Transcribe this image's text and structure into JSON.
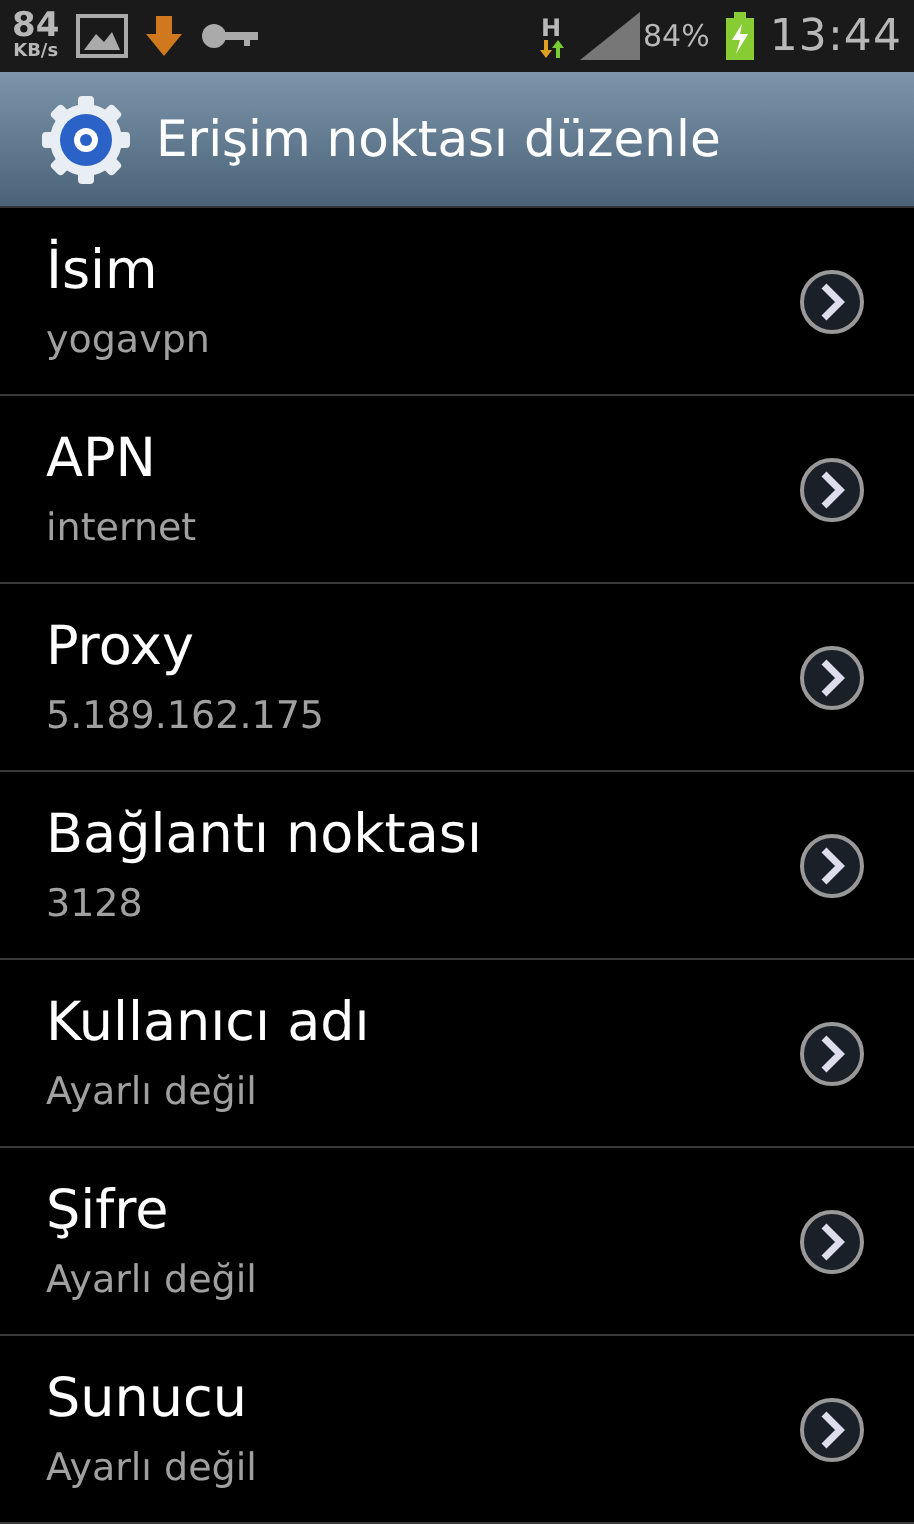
{
  "status_bar": {
    "speed": "84",
    "speed_unit": "KB/s",
    "network_type": "H",
    "battery": "84%",
    "time": "13:44"
  },
  "header": {
    "title": "Erişim noktası düzenle"
  },
  "settings": [
    {
      "label": "İsim",
      "value": "yogavpn"
    },
    {
      "label": "APN",
      "value": "internet"
    },
    {
      "label": "Proxy",
      "value": "5.189.162.175"
    },
    {
      "label": "Bağlantı noktası",
      "value": "3128"
    },
    {
      "label": "Kullanıcı adı",
      "value": "Ayarlı değil"
    },
    {
      "label": "Şifre",
      "value": "Ayarlı değil"
    },
    {
      "label": "Sunucu",
      "value": "Ayarlı değil"
    }
  ]
}
